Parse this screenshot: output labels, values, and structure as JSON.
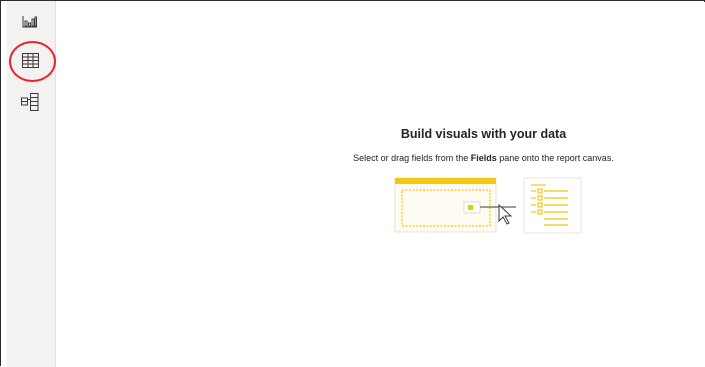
{
  "view_rail": {
    "items": [
      {
        "name": "report-view",
        "icon": "bar-chart-icon"
      },
      {
        "name": "data-view",
        "icon": "table-icon",
        "highlighted": true
      },
      {
        "name": "model-view",
        "icon": "model-icon"
      }
    ],
    "highlight_color": "#e8252f"
  },
  "empty_state": {
    "title": "Build visuals with your data",
    "subtitle_before": "Select or drag fields from the ",
    "subtitle_bold": "Fields",
    "subtitle_after": " pane onto the report canvas.",
    "illustration_icon": "drag-fields-illustration",
    "accent_color": "#f2c811"
  }
}
